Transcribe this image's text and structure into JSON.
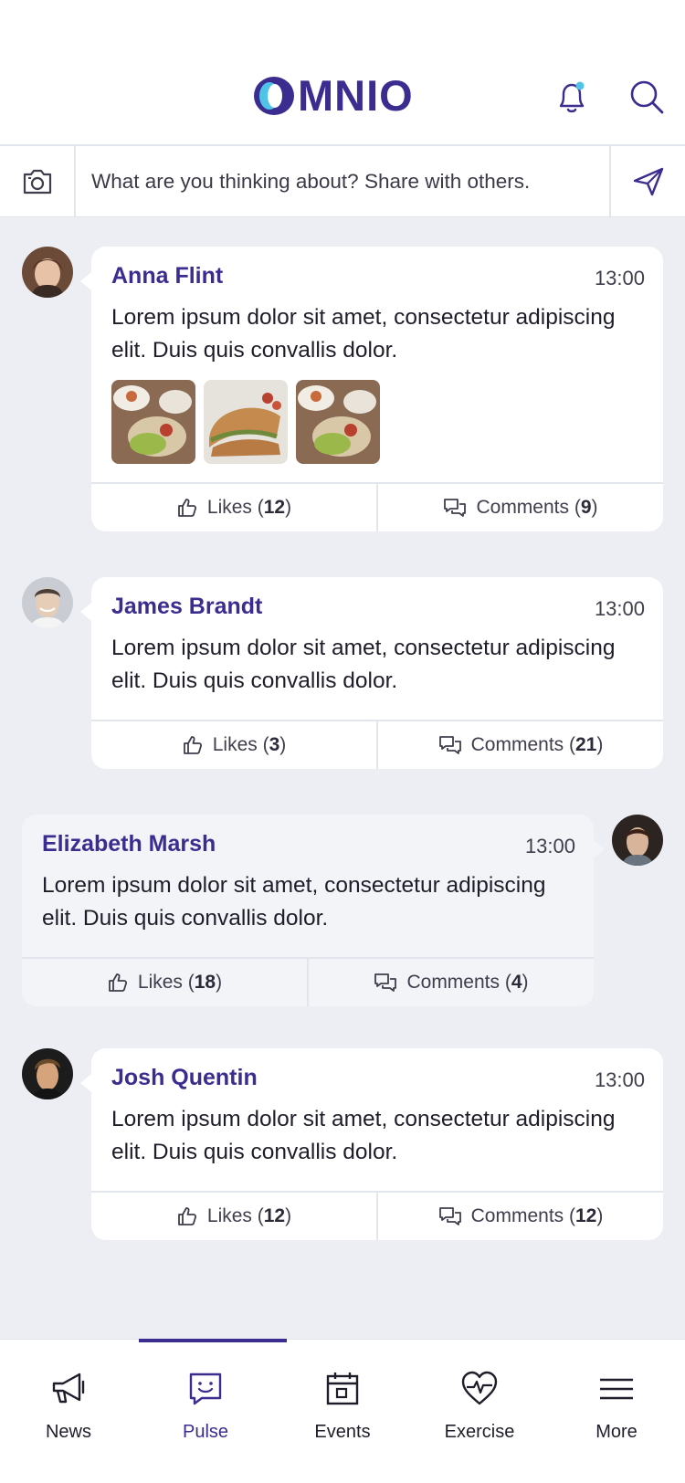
{
  "header": {
    "logo_text": "MNIO",
    "brand_color": "#3b2d90",
    "accent_color": "#4fc3e8"
  },
  "composer": {
    "placeholder": "What are you thinking about? Share with others."
  },
  "posts": [
    {
      "author": "Anna Flint",
      "time": "13:00",
      "text": "Lorem ipsum dolor sit amet, consectetur adipiscing elit. Duis quis convallis dolor.",
      "likes_label": "Likes (",
      "likes": "12",
      "comments_label": "Comments (",
      "comments": "9",
      "close": ")"
    },
    {
      "author": "James Brandt",
      "time": "13:00",
      "text": "Lorem ipsum dolor sit amet, consectetur adipiscing elit. Duis quis convallis dolor.",
      "likes_label": "Likes (",
      "likes": "3",
      "comments_label": "Comments (",
      "comments": "21",
      "close": ")"
    },
    {
      "author": "Elizabeth Marsh",
      "time": "13:00",
      "text": "Lorem ipsum dolor sit amet, consectetur adipiscing elit. Duis quis convallis dolor.",
      "likes_label": "Likes (",
      "likes": "18",
      "comments_label": "Comments (",
      "comments": "4",
      "close": ")"
    },
    {
      "author": "Josh Quentin",
      "time": "13:00",
      "text": "Lorem ipsum dolor sit amet, consectetur adipiscing elit. Duis quis convallis dolor.",
      "likes_label": "Likes (",
      "likes": "12",
      "comments_label": "Comments (",
      "comments": "12",
      "close": ")"
    }
  ],
  "nav": {
    "items": [
      {
        "label": "News",
        "icon": "megaphone-icon"
      },
      {
        "label": "Pulse",
        "icon": "chat-smile-icon"
      },
      {
        "label": "Events",
        "icon": "calendar-icon"
      },
      {
        "label": "Exercise",
        "icon": "heart-pulse-icon"
      },
      {
        "label": "More",
        "icon": "menu-icon"
      }
    ],
    "active": "Pulse"
  }
}
